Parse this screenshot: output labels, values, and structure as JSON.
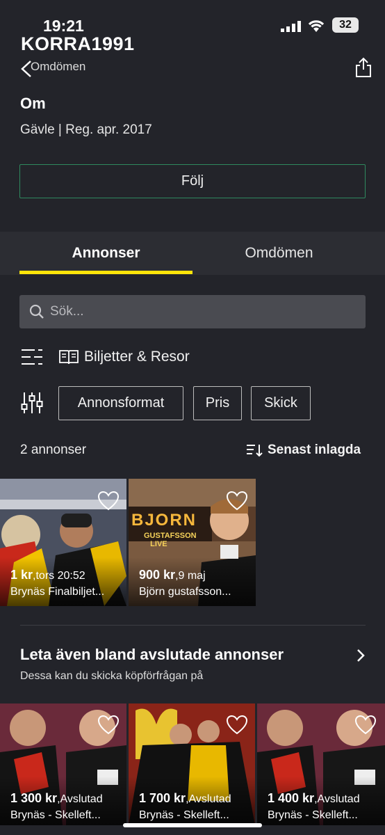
{
  "status_bar": {
    "time": "19:21",
    "battery": "32"
  },
  "header": {
    "username": "KORRA1991",
    "reviews_link": "Omdömen"
  },
  "about": {
    "title": "Om",
    "subtitle": "Gävle | Reg. apr. 2017",
    "follow_label": "Följ"
  },
  "tabs": [
    {
      "label": "Annonser",
      "active": true
    },
    {
      "label": "Omdömen",
      "active": false
    }
  ],
  "colors": {
    "accent": "#ffe40a",
    "follow_border": "#2f8a5f",
    "background": "#23242a"
  },
  "search": {
    "placeholder": "Sök..."
  },
  "category": {
    "label": "Biljetter & Resor",
    "icon": "book-icon"
  },
  "filters": [
    "Annonsformat",
    "Pris",
    "Skick"
  ],
  "results": {
    "count": "2 annonser",
    "sort_label": "Senast inlagda"
  },
  "listings": [
    {
      "price": "1 kr",
      "time": ",tors 20:52",
      "title": "Brynäs Finalbiljet..."
    },
    {
      "price": "900 kr",
      "time": ",9 maj",
      "title": "Björn gustafsson..."
    }
  ],
  "closed_section": {
    "title": "Leta även bland avslutade annonser",
    "subtitle": "Dessa kan du skicka köpförfrågan på"
  },
  "closed_listings": [
    {
      "price": "1 300 kr",
      "status": ",Avslutad",
      "title": "Brynäs - Skelleft..."
    },
    {
      "price": "1 700 kr",
      "status": ",Avslutad",
      "title": "Brynäs - Skelleft..."
    },
    {
      "price": "1 400 kr",
      "status": ",Avslutad",
      "title": "Brynäs - Skelleft..."
    }
  ]
}
